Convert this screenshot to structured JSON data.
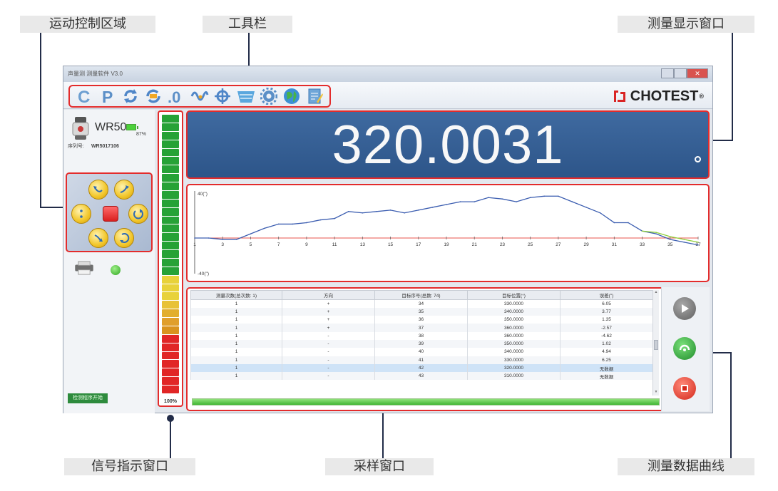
{
  "callouts": {
    "motion": "运动控制区域",
    "toolbar": "工具栏",
    "display": "测量显示窗口",
    "signal": "信号指示窗口",
    "sampling": "采样窗口",
    "curve": "测量数据曲线"
  },
  "window": {
    "title": "声量测 测量软件 V3.0"
  },
  "toolbar": {
    "items": [
      {
        "name": "c-icon",
        "glyph": "C"
      },
      {
        "name": "p-icon",
        "glyph": "P"
      },
      {
        "name": "refresh-icon"
      },
      {
        "name": "refresh-arrow-icon"
      },
      {
        "name": "zero-icon",
        "glyph": ".0"
      },
      {
        "name": "wave-icon"
      },
      {
        "name": "crosshair-icon"
      },
      {
        "name": "basket-icon"
      },
      {
        "name": "gear-icon"
      },
      {
        "name": "globe-icon"
      },
      {
        "name": "notepad-icon"
      }
    ]
  },
  "brand": {
    "text": "CHOTEST",
    "reg": "®"
  },
  "device": {
    "name": "WR50",
    "battery_percent": 87,
    "battery_label": "87%",
    "serial_label": "序列号:",
    "serial_value": "WR5017106"
  },
  "left_button": "检测程序开始",
  "signal": {
    "percent_label": "100%",
    "cells": [
      "#26a236",
      "#26a236",
      "#26a236",
      "#26a236",
      "#26a236",
      "#26a236",
      "#26a236",
      "#26a236",
      "#26a236",
      "#26a236",
      "#26a236",
      "#26a236",
      "#26a236",
      "#26a236",
      "#26a236",
      "#26a236",
      "#26a236",
      "#26a236",
      "#26a236",
      "#e8d23a",
      "#e8d23a",
      "#e8d23a",
      "#e8c236",
      "#e2ae2e",
      "#e09f2c",
      "#d9931e",
      "#e12626",
      "#e12626",
      "#e12626",
      "#e12626",
      "#e12626",
      "#e12626",
      "#e12626"
    ]
  },
  "display": {
    "value": "320.0031",
    "unit_icon": "degree-icon"
  },
  "chart_data": {
    "type": "line",
    "ymax_label": "40(\")",
    "ymin_label": "-40(\")",
    "ylim": [
      -40,
      40
    ],
    "x_ticks": [
      "1",
      "3",
      "5",
      "7",
      "9",
      "11",
      "13",
      "15",
      "17",
      "19",
      "21",
      "23",
      "25",
      "27",
      "29",
      "31",
      "33",
      "35",
      "37"
    ],
    "xlim": [
      1,
      37
    ],
    "series": [
      {
        "color": "#3b5db0",
        "x": [
          1,
          2,
          3,
          4,
          5,
          6,
          7,
          8,
          9,
          10,
          11,
          12,
          13,
          14,
          15,
          16,
          17,
          18,
          19,
          20,
          21,
          22,
          23,
          24,
          25,
          26,
          27,
          28,
          29,
          30,
          31,
          32,
          33,
          34,
          35,
          36,
          37
        ],
        "y": [
          0,
          0,
          -1,
          -1,
          3,
          7,
          10,
          10,
          11,
          13,
          14,
          19,
          18,
          19,
          20,
          18,
          20,
          22,
          24,
          26,
          26,
          29,
          28,
          26,
          29,
          30,
          30,
          26,
          22,
          18,
          11,
          11,
          5,
          3,
          -1,
          -3,
          -5
        ]
      },
      {
        "color": "#8fcf3a",
        "x": [
          33,
          34,
          35,
          36,
          37
        ],
        "y": [
          5,
          4,
          1,
          -1,
          -3
        ]
      }
    ],
    "zero_line_color": "#e8554e"
  },
  "sampling": {
    "columns": [
      "测量次数(总次数: 1)",
      "方向",
      "目标序号(总数: 74)",
      "目标位置(°)",
      "误差(\")"
    ],
    "rows": [
      [
        "1",
        "+",
        "34",
        "330.0000",
        "6.05"
      ],
      [
        "1",
        "+",
        "35",
        "340.0000",
        "3.77"
      ],
      [
        "1",
        "+",
        "36",
        "350.0000",
        "1.35"
      ],
      [
        "1",
        "+",
        "37",
        "360.0000",
        "-2.57"
      ],
      [
        "1",
        "-",
        "38",
        "360.0000",
        "-4.62"
      ],
      [
        "1",
        "-",
        "39",
        "350.0000",
        "1.02"
      ],
      [
        "1",
        "-",
        "40",
        "340.0000",
        "4.94"
      ],
      [
        "1",
        "-",
        "41",
        "330.0000",
        "6.25"
      ],
      [
        "1",
        "-",
        "42",
        "320.0000",
        "无数据"
      ],
      [
        "1",
        "-",
        "43",
        "310.0000",
        "无数据"
      ]
    ],
    "selected_row": 8,
    "progress": 1.0
  },
  "controls": {
    "play": "play-icon",
    "measure": "measure-icon",
    "stop": "stop-icon"
  },
  "colors": {
    "accent_red": "#e32c2c",
    "display_bg": "#3a649b",
    "callout_line": "#222c48"
  }
}
